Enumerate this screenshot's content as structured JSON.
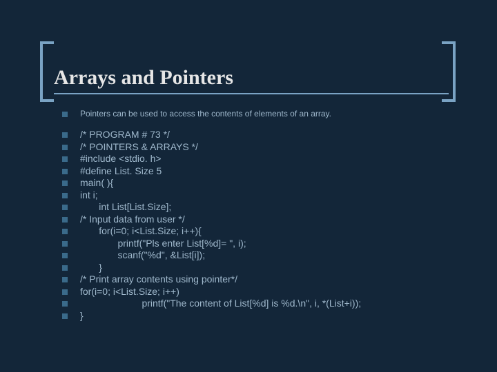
{
  "title": "Arrays and Pointers",
  "intro": "Pointers can be used to access the contents of elements of an array.",
  "code_lines": [
    "/* PROGRAM # 73 */",
    "/* POINTERS & ARRAYS */",
    "#include <stdio. h>",
    "#define List. Size 5",
    "main( ){",
    "int i;",
    "       int List[List.Size];",
    "/* Input data from user */",
    "       for(i=0; i<List.Size; i++){",
    "              printf(\"Pls enter List[%d]= \", i);",
    "              scanf(\"%d\", &List[i]);",
    "       }",
    "/* Print array contents using pointer*/",
    "for(i=0; i<List.Size; i++)",
    "                       printf(\"The content of List[%d] is %d.\\n\", i, *(List+i));",
    "}"
  ]
}
